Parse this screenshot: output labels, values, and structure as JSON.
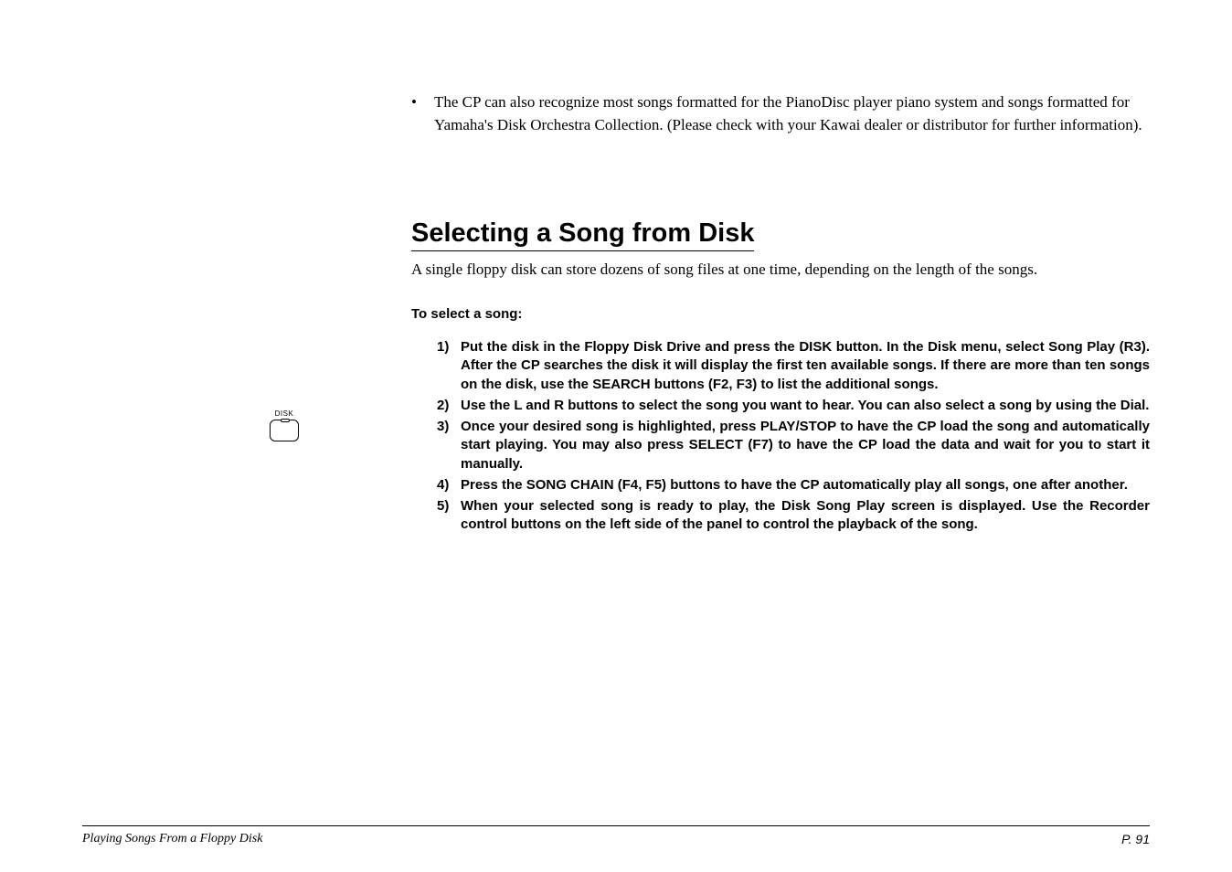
{
  "intro": {
    "bullet_text": "The CP can also recognize most songs formatted for the PianoDisc player piano system and songs formatted for Yamaha's Disk Orchestra Collection. (Please check with your Kawai dealer or distributor for further information)."
  },
  "section": {
    "heading": "Selecting a Song from Disk",
    "description": "A single floppy disk can store dozens of song files at one time, depending on the length of the songs.",
    "instruction_title": "To select a song:"
  },
  "steps": [
    {
      "num": "1)",
      "text": "Put the disk in the Floppy Disk Drive and press the DISK button.  In the Disk menu, select Song Play (R3).  After the CP searches the disk it will display the first ten available songs.  If there are more than ten songs on the disk, use the SEARCH buttons (F2, F3) to list the additional songs."
    },
    {
      "num": "2)",
      "text": "Use the L and R buttons to select the song you want to hear.  You can also select a song by using the Dial."
    },
    {
      "num": "3)",
      "text": "Once your desired song is highlighted, press PLAY/STOP to have the CP load the song and automatically start playing.  You may also press SELECT (F7) to have the CP load the data and wait for you to start it manually."
    },
    {
      "num": "4)",
      "text": "Press the SONG CHAIN (F4, F5) buttons to have the CP automatically play all songs, one after another."
    },
    {
      "num": "5)",
      "text": "When your selected song is ready to play, the Disk Song Play screen is displayed.  Use the Recorder control buttons on the left side of the panel to control the playback of the song."
    }
  ],
  "icon": {
    "label": "DISK"
  },
  "footer": {
    "left": "Playing Songs From a Floppy Disk",
    "right": "P. 91"
  }
}
